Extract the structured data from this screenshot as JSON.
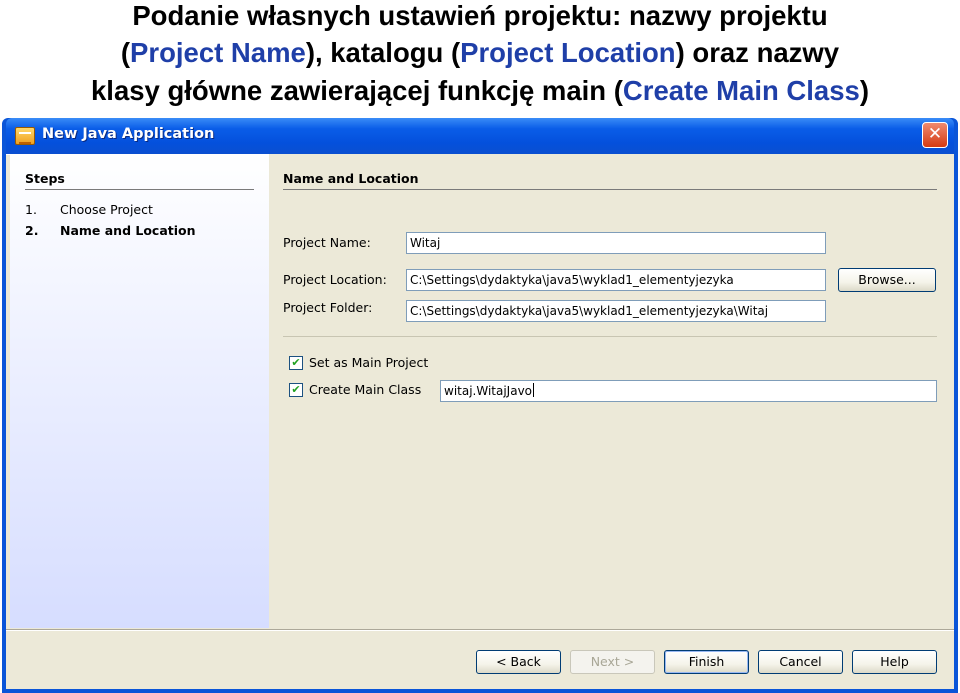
{
  "caption": {
    "line1": "Podanie własnych ustawień projektu: nazwy projektu",
    "line2_open": "(",
    "line2_blue1": "Project Name",
    "line2_mid": "), katalogu (",
    "line2_blue2": "Project Location",
    "line2_end": ") oraz nazwy",
    "line3_start": "klasy główne zawierającej funkcję main (",
    "line3_blue": "Create Main Class",
    "line3_end": ")"
  },
  "window": {
    "title": "New Java Application",
    "close_glyph": "✕"
  },
  "steps": {
    "heading": "Steps",
    "items": [
      {
        "num": "1.",
        "label": "Choose Project"
      },
      {
        "num": "2.",
        "label": "Name and Location"
      }
    ]
  },
  "panel": {
    "heading": "Name and Location",
    "project_name_label": "Project Name:",
    "project_name_value": "Witaj",
    "project_location_label": "Project Location:",
    "project_location_value": "C:\\Settings\\dydaktyka\\java5\\wyklad1_elementyjezyka",
    "browse_label": "Browse...",
    "project_folder_label": "Project Folder:",
    "project_folder_value": "C:\\Settings\\dydaktyka\\java5\\wyklad1_elementyjezyka\\Witaj",
    "set_main_label": "Set as Main Project",
    "set_main_checked": true,
    "create_main_label": "Create Main Class",
    "create_main_checked": true,
    "main_class_value": "witaj.WitajJavo"
  },
  "buttons": {
    "back": "< Back",
    "next": "Next >",
    "finish": "Finish",
    "cancel": "Cancel",
    "help": "Help"
  },
  "colors": {
    "caption_accent": "#1f3fa8",
    "titlebar": "#0a55d8",
    "dialog_bg": "#ece9d8"
  }
}
